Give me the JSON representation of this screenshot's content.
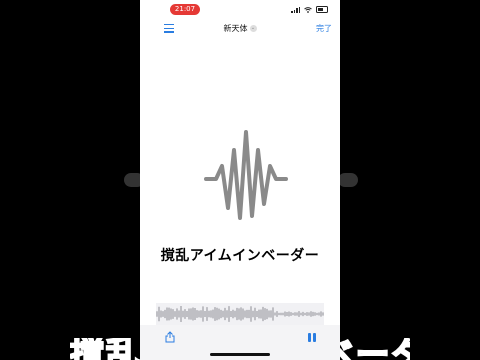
{
  "status_bar": {
    "time": "21:07"
  },
  "nav": {
    "title": "新天体",
    "done_label": "完了"
  },
  "caption": "撹乱アイムインベーダー",
  "background_caption": "撹乱アイムインベーダー",
  "icons": [
    "list-icon",
    "dropdown-icon",
    "audio-wave-icon",
    "share-icon",
    "pause-icon",
    "signal-icon",
    "wifi-icon",
    "battery-icon"
  ],
  "colors": {
    "accent": "#2a7de1",
    "recording_pill": "#e53935",
    "wave_icon": "#8a8a8a"
  }
}
